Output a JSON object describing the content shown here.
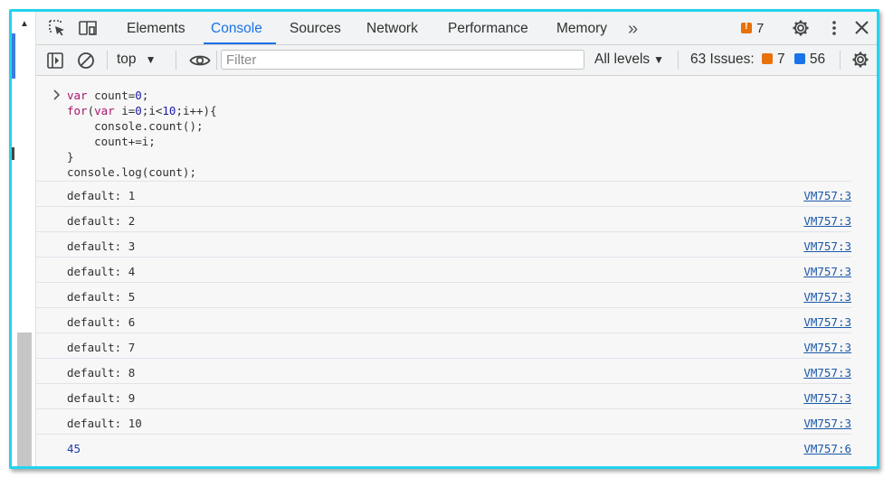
{
  "tabs": [
    {
      "label": "Elements"
    },
    {
      "label": "Console"
    },
    {
      "label": "Sources"
    },
    {
      "label": "Network"
    },
    {
      "label": "Performance"
    },
    {
      "label": "Memory"
    }
  ],
  "more_tabs": "»",
  "issue_badge_count": "7",
  "toolbar": {
    "context": "top",
    "filter_placeholder": "Filter",
    "levels": "All levels",
    "issues_label": "63 Issues:",
    "issues_warning_count": "7",
    "issues_info_count": "56"
  },
  "code_lines": [
    {
      "parts": [
        {
          "t": "var",
          "c": "kw"
        },
        {
          "t": " count=",
          "c": ""
        },
        {
          "t": "0",
          "c": "num"
        },
        {
          "t": ";",
          "c": ""
        }
      ]
    },
    {
      "parts": [
        {
          "t": "for",
          "c": "kw"
        },
        {
          "t": "(",
          "c": ""
        },
        {
          "t": "var",
          "c": "kw"
        },
        {
          "t": " i=",
          "c": ""
        },
        {
          "t": "0",
          "c": "num"
        },
        {
          "t": ";i<",
          "c": ""
        },
        {
          "t": "10",
          "c": "num"
        },
        {
          "t": ";i++){",
          "c": ""
        }
      ]
    },
    {
      "parts": [
        {
          "t": "    console.count();",
          "c": ""
        }
      ]
    },
    {
      "parts": [
        {
          "t": "    count+=i;",
          "c": ""
        }
      ]
    },
    {
      "parts": [
        {
          "t": "}",
          "c": ""
        }
      ]
    },
    {
      "parts": [
        {
          "t": "console.log(count);",
          "c": ""
        }
      ]
    }
  ],
  "log_rows": [
    {
      "message": "default: 1",
      "source": "VM757:3"
    },
    {
      "message": "default: 2",
      "source": "VM757:3"
    },
    {
      "message": "default: 3",
      "source": "VM757:3"
    },
    {
      "message": "default: 4",
      "source": "VM757:3"
    },
    {
      "message": "default: 5",
      "source": "VM757:3"
    },
    {
      "message": "default: 6",
      "source": "VM757:3"
    },
    {
      "message": "default: 7",
      "source": "VM757:3"
    },
    {
      "message": "default: 8",
      "source": "VM757:3"
    },
    {
      "message": "default: 9",
      "source": "VM757:3"
    },
    {
      "message": "default: 10",
      "source": "VM757:3"
    },
    {
      "message": "45",
      "source": "VM757:6",
      "result": true
    }
  ],
  "colors": {
    "accent": "#1a73e8",
    "warning": "#e8710a",
    "info": "#1a73e8",
    "frame": "#22d3ee"
  },
  "icons": [
    "inspect-element-icon",
    "device-toolbar-icon",
    "more-tabs-icon",
    "settings-gear-icon",
    "kebab-menu-icon",
    "close-icon",
    "sidebar-toggle-icon",
    "clear-console-icon",
    "dropdown-arrow-icon",
    "live-expression-eye-icon",
    "prompt-chevron-icon"
  ]
}
